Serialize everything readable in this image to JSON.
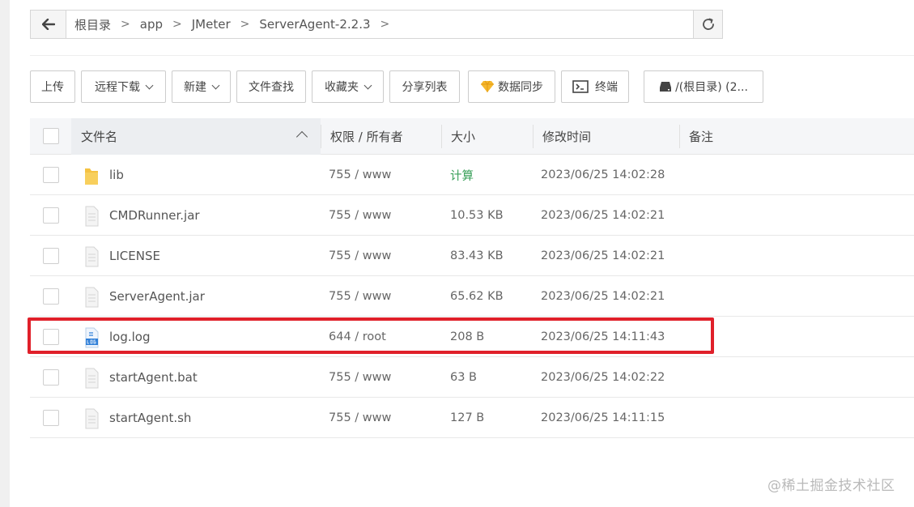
{
  "breadcrumb": {
    "items": [
      "根目录",
      "app",
      "JMeter",
      "ServerAgent-2.2.3"
    ],
    "separator": ">"
  },
  "toolbar": {
    "upload": "上传",
    "remote_download": "远程下载",
    "new": "新建",
    "file_search": "文件查找",
    "favorites": "收藏夹",
    "share_list": "分享列表",
    "data_sync": "数据同步",
    "terminal": "终端",
    "disk": "/(根目录) (2..."
  },
  "table": {
    "headers": {
      "name": "文件名",
      "permission": "权限 / 所有者",
      "size": "大小",
      "modified": "修改时间",
      "remark": "备注"
    },
    "rows": [
      {
        "name": "lib",
        "perm": "755 / www",
        "size": "计算",
        "time": "2023/06/25 14:02:28",
        "type": "folder"
      },
      {
        "name": "CMDRunner.jar",
        "perm": "755 / www",
        "size": "10.53 KB",
        "time": "2023/06/25 14:02:21",
        "type": "file"
      },
      {
        "name": "LICENSE",
        "perm": "755 / www",
        "size": "83.43 KB",
        "time": "2023/06/25 14:02:21",
        "type": "file"
      },
      {
        "name": "ServerAgent.jar",
        "perm": "755 / www",
        "size": "65.62 KB",
        "time": "2023/06/25 14:02:21",
        "type": "file"
      },
      {
        "name": "log.log",
        "perm": "644 / root",
        "size": "208 B",
        "time": "2023/06/25 14:11:43",
        "type": "log"
      },
      {
        "name": "startAgent.bat",
        "perm": "755 / www",
        "size": "63 B",
        "time": "2023/06/25 14:02:22",
        "type": "file"
      },
      {
        "name": "startAgent.sh",
        "perm": "755 / www",
        "size": "127 B",
        "time": "2023/06/25 14:11:15",
        "type": "file"
      }
    ]
  },
  "watermark": "@稀土掘金技术社区",
  "colors": {
    "highlight": "#e0202a",
    "calc_link": "#3aa05a",
    "folder": "#f5c242",
    "log_icon": "#2f7fd8"
  }
}
